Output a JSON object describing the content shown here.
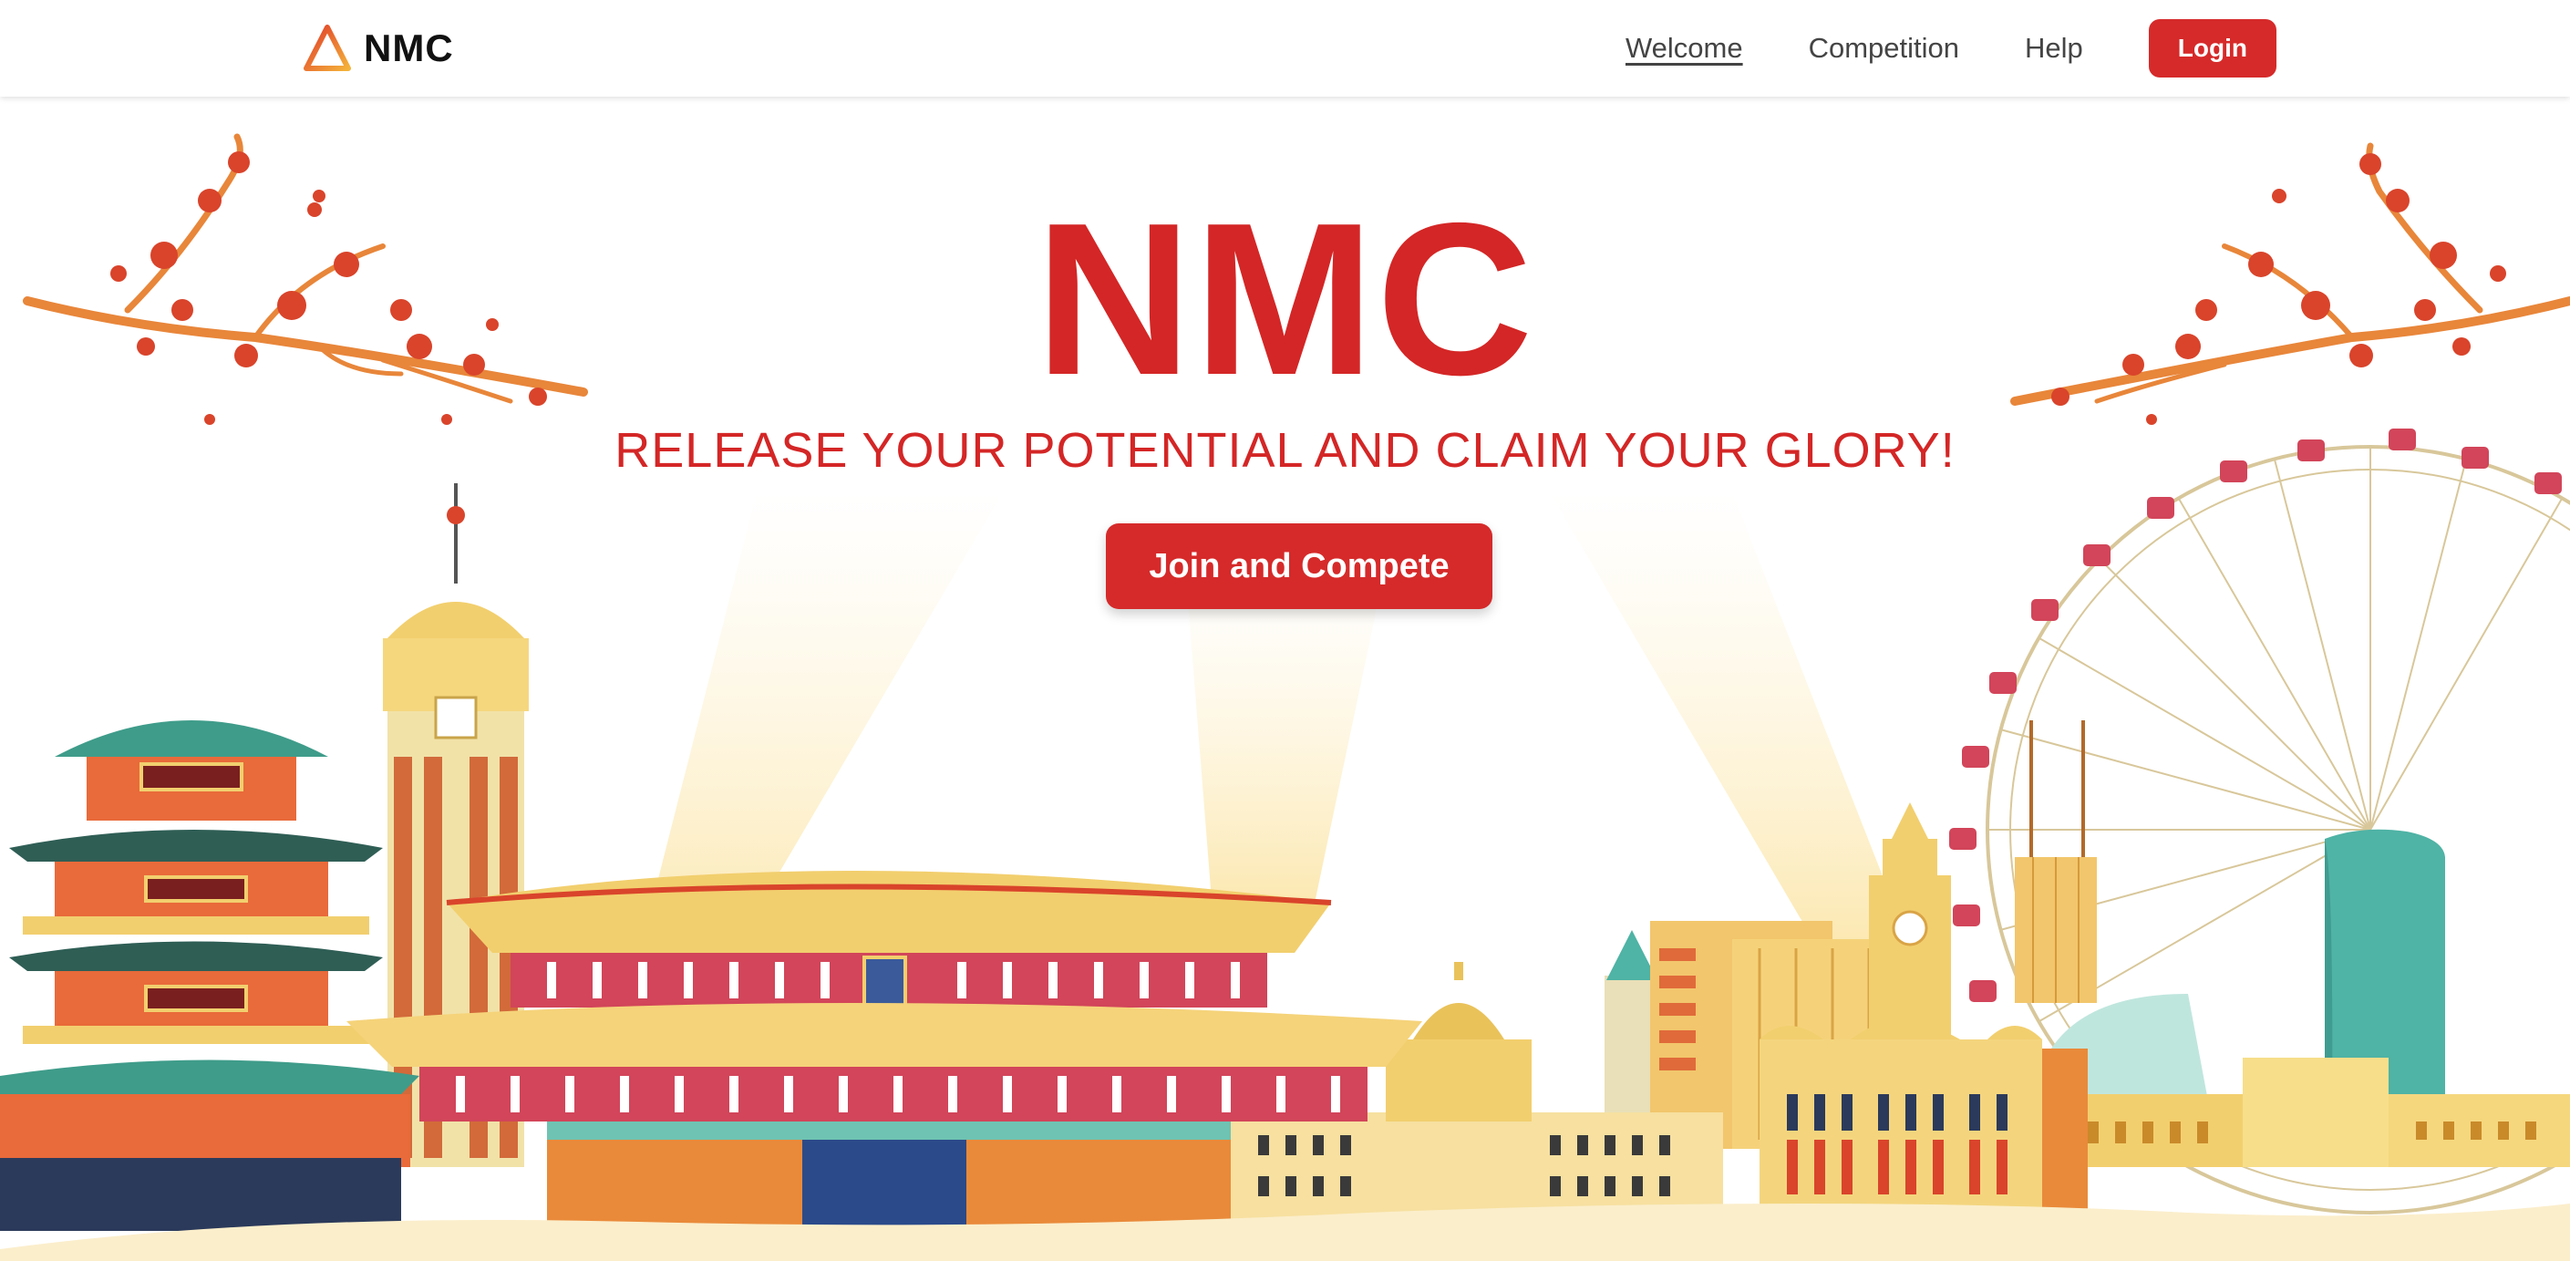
{
  "header": {
    "brand_name": "NMC",
    "logo_icon": "triangle-logo-icon",
    "nav": [
      {
        "label": "Welcome",
        "active": true
      },
      {
        "label": "Competition",
        "active": false
      },
      {
        "label": "Help",
        "active": false
      }
    ],
    "login_label": "Login"
  },
  "hero": {
    "title": "NMC",
    "tagline": "RELEASE YOUR POTENTIAL AND CLAIM YOUR GLORY!",
    "cta_label": "Join and Compete"
  },
  "illustration": {
    "name": "city-skyline-illustration",
    "elements": [
      "plum-blossom-branch-left",
      "plum-blossom-branch-right",
      "pagoda",
      "clock-tower",
      "palace-hall",
      "ferris-wheel",
      "modern-buildings"
    ]
  },
  "colors": {
    "brand_red": "#d62a2a",
    "title_red": "#d42626",
    "gold": "#f2cf6e",
    "teal": "#4fb3a5",
    "sand": "#fbeecb"
  }
}
